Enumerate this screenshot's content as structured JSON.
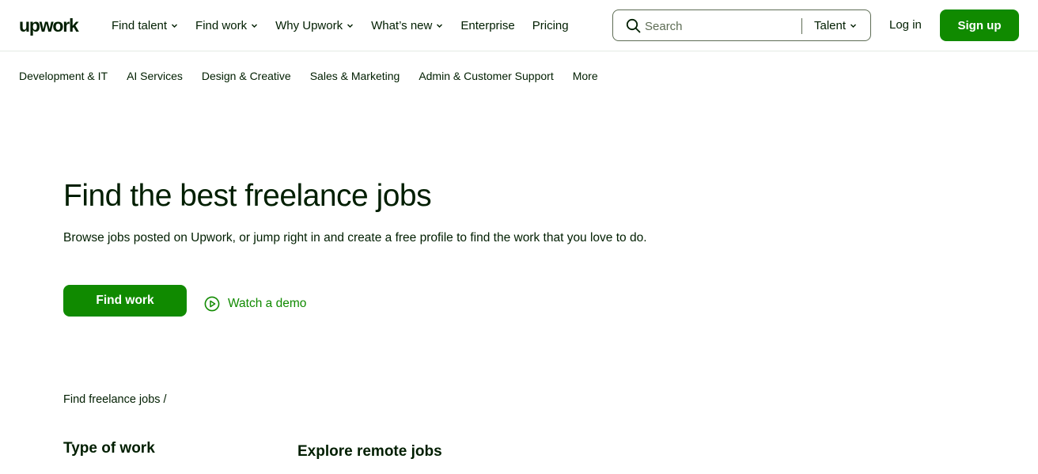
{
  "header": {
    "logo": "upwork",
    "nav": [
      {
        "label": "Find talent",
        "dropdown": true
      },
      {
        "label": "Find work",
        "dropdown": true
      },
      {
        "label": "Why Upwork",
        "dropdown": true
      },
      {
        "label": "What’s new",
        "dropdown": true
      },
      {
        "label": "Enterprise",
        "dropdown": false
      },
      {
        "label": "Pricing",
        "dropdown": false
      }
    ],
    "search": {
      "placeholder": "Search",
      "value": "",
      "type_selected": "Talent",
      "icon": "search-icon"
    },
    "login_label": "Log in",
    "signup_label": "Sign up"
  },
  "categories": [
    "Development & IT",
    "AI Services",
    "Design & Creative",
    "Sales & Marketing",
    "Admin & Customer Support",
    "More"
  ],
  "hero": {
    "title": "Find the best freelance jobs",
    "subtitle": "Browse jobs posted on Upwork, or jump right in and create a free profile to find the work that you love to do.",
    "primary_button": "Find work",
    "demo_link": "Watch a demo"
  },
  "breadcrumb": "Find freelance jobs /",
  "sections": {
    "type_of_work": "Type of work",
    "explore": "Explore remote jobs"
  },
  "colors": {
    "brand": "#108a00",
    "text": "#001e00",
    "muted": "#5e6d55",
    "divider": "#e4ebe4"
  }
}
